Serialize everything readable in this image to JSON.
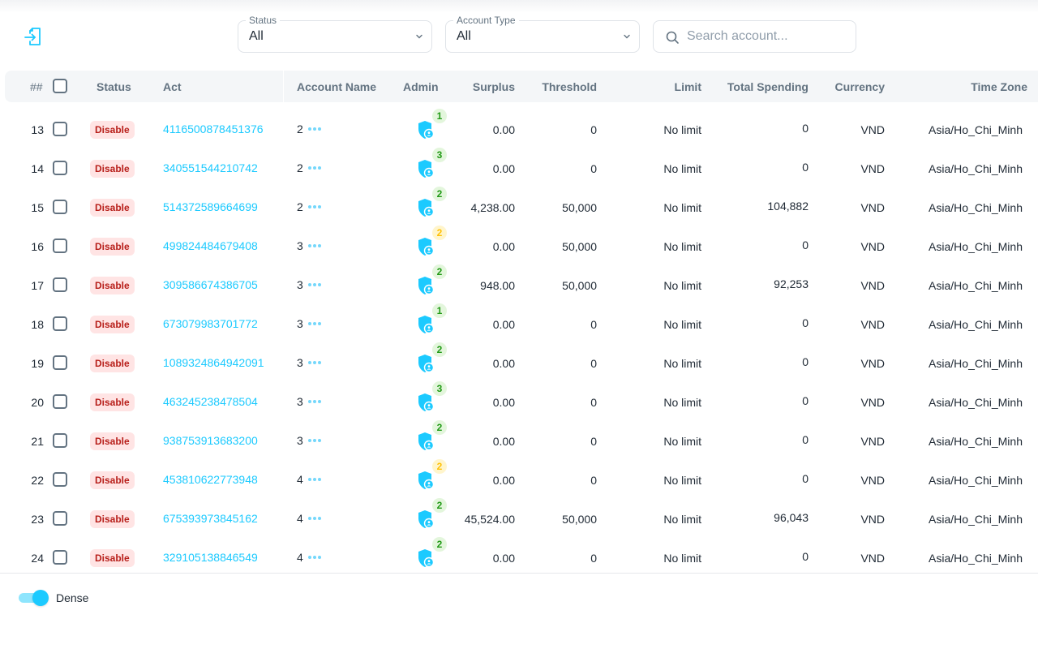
{
  "toolbar": {
    "export_icon": "export-file-icon",
    "status_filter": {
      "label": "Status",
      "value": "All"
    },
    "account_type_filter": {
      "label": "Account Type",
      "value": "All"
    },
    "search": {
      "placeholder": "Search account...",
      "value": ""
    }
  },
  "table": {
    "columns": {
      "index": "##",
      "status": "Status",
      "act": "Act",
      "account_name": "Account Name",
      "admin": "Admin",
      "surplus": "Surplus",
      "threshold": "Threshold",
      "limit": "Limit",
      "total_spending": "Total Spending",
      "currency": "Currency",
      "time_zone": "Time Zone"
    },
    "rows": [
      {
        "index": "13",
        "status": "Disable",
        "act": "4116500878451376",
        "account_name": "2",
        "admin_count": "1",
        "admin_color": "green",
        "surplus": "0.00",
        "threshold": "0",
        "limit": "No limit",
        "total_spending": "0",
        "currency": "VND",
        "time_zone": "Asia/Ho_Chi_Minh"
      },
      {
        "index": "14",
        "status": "Disable",
        "act": "340551544210742",
        "account_name": "2",
        "admin_count": "3",
        "admin_color": "green",
        "surplus": "0.00",
        "threshold": "0",
        "limit": "No limit",
        "total_spending": "0",
        "currency": "VND",
        "time_zone": "Asia/Ho_Chi_Minh"
      },
      {
        "index": "15",
        "status": "Disable",
        "act": "514372589664699",
        "account_name": "2",
        "admin_count": "2",
        "admin_color": "green",
        "surplus": "4,238.00",
        "threshold": "50,000",
        "limit": "No limit",
        "total_spending": "104,882",
        "currency": "VND",
        "time_zone": "Asia/Ho_Chi_Minh"
      },
      {
        "index": "16",
        "status": "Disable",
        "act": "499824484679408",
        "account_name": "3",
        "admin_count": "2",
        "admin_color": "yellow",
        "surplus": "0.00",
        "threshold": "50,000",
        "limit": "No limit",
        "total_spending": "0",
        "currency": "VND",
        "time_zone": "Asia/Ho_Chi_Minh"
      },
      {
        "index": "17",
        "status": "Disable",
        "act": "309586674386705",
        "account_name": "3",
        "admin_count": "2",
        "admin_color": "green",
        "surplus": "948.00",
        "threshold": "50,000",
        "limit": "No limit",
        "total_spending": "92,253",
        "currency": "VND",
        "time_zone": "Asia/Ho_Chi_Minh"
      },
      {
        "index": "18",
        "status": "Disable",
        "act": "673079983701772",
        "account_name": "3",
        "admin_count": "1",
        "admin_color": "green",
        "surplus": "0.00",
        "threshold": "0",
        "limit": "No limit",
        "total_spending": "0",
        "currency": "VND",
        "time_zone": "Asia/Ho_Chi_Minh"
      },
      {
        "index": "19",
        "status": "Disable",
        "act": "1089324864942091",
        "account_name": "3",
        "admin_count": "2",
        "admin_color": "green",
        "surplus": "0.00",
        "threshold": "0",
        "limit": "No limit",
        "total_spending": "0",
        "currency": "VND",
        "time_zone": "Asia/Ho_Chi_Minh"
      },
      {
        "index": "20",
        "status": "Disable",
        "act": "463245238478504",
        "account_name": "3",
        "admin_count": "3",
        "admin_color": "green",
        "surplus": "0.00",
        "threshold": "0",
        "limit": "No limit",
        "total_spending": "0",
        "currency": "VND",
        "time_zone": "Asia/Ho_Chi_Minh"
      },
      {
        "index": "21",
        "status": "Disable",
        "act": "938753913683200",
        "account_name": "3",
        "admin_count": "2",
        "admin_color": "green",
        "surplus": "0.00",
        "threshold": "0",
        "limit": "No limit",
        "total_spending": "0",
        "currency": "VND",
        "time_zone": "Asia/Ho_Chi_Minh"
      },
      {
        "index": "22",
        "status": "Disable",
        "act": "453810622773948",
        "account_name": "4",
        "admin_count": "2",
        "admin_color": "yellow",
        "surplus": "0.00",
        "threshold": "0",
        "limit": "No limit",
        "total_spending": "0",
        "currency": "VND",
        "time_zone": "Asia/Ho_Chi_Minh"
      },
      {
        "index": "23",
        "status": "Disable",
        "act": "675393973845162",
        "account_name": "4",
        "admin_count": "2",
        "admin_color": "green",
        "surplus": "45,524.00",
        "threshold": "50,000",
        "limit": "No limit",
        "total_spending": "96,043",
        "currency": "VND",
        "time_zone": "Asia/Ho_Chi_Minh"
      },
      {
        "index": "24",
        "status": "Disable",
        "act": "329105138846549",
        "account_name": "4",
        "admin_count": "2",
        "admin_color": "green",
        "surplus": "0.00",
        "threshold": "0",
        "limit": "No limit",
        "total_spending": "0",
        "currency": "VND",
        "time_zone": "Asia/Ho_Chi_Minh"
      }
    ]
  },
  "footer": {
    "dense_label": "Dense",
    "dense_enabled": true
  },
  "colors": {
    "accent": "#1ccaff",
    "status_disable_bg": "#ffe4e4",
    "status_disable_text": "#b71d18",
    "admin_green_bg": "#e3f6dc",
    "admin_green_text": "#229a16",
    "admin_yellow_bg": "#fff5cc",
    "admin_yellow_text": "#ffc107"
  }
}
